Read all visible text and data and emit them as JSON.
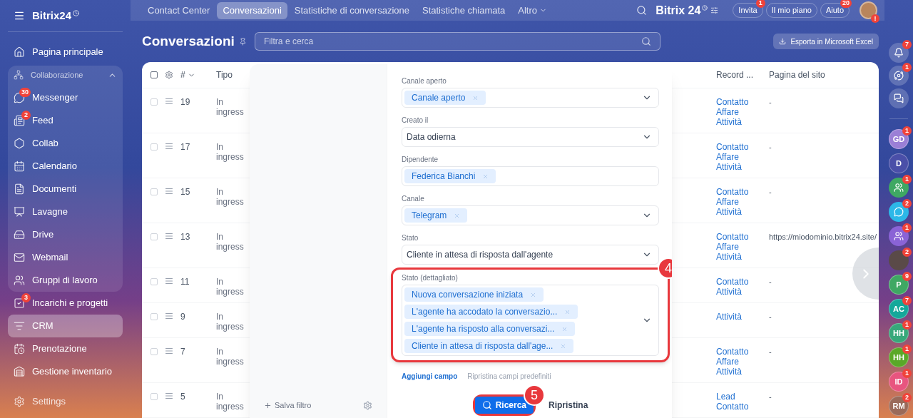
{
  "brand": {
    "name": "Bitrix24"
  },
  "sidebar": {
    "items": [
      {
        "label": "Pagina principale",
        "selected": false
      },
      {
        "label": "Collaborazione",
        "expanded": true,
        "children": [
          {
            "label": "Messenger",
            "badge": "30",
            "selected": false
          },
          {
            "label": "Feed",
            "badge": "2",
            "selected": false
          },
          {
            "label": "Collab",
            "selected": false
          },
          {
            "label": "Calendario",
            "selected": false
          },
          {
            "label": "Documenti",
            "selected": false
          },
          {
            "label": "Lavagne",
            "selected": false
          },
          {
            "label": "Drive",
            "selected": false
          },
          {
            "label": "Webmail",
            "selected": false
          },
          {
            "label": "Gruppi di lavoro",
            "selected": false
          }
        ]
      },
      {
        "label": "Incarichi e progetti",
        "badge": "3",
        "selected": false
      },
      {
        "label": "CRM",
        "selected": true
      },
      {
        "label": "Prenotazione",
        "selected": false
      },
      {
        "label": "Gestione inventario",
        "selected": false
      }
    ],
    "settings": "Settings"
  },
  "top_nav": {
    "tabs": [
      {
        "label": "Contact Center",
        "selected": false
      },
      {
        "label": "Conversazioni",
        "selected": true
      },
      {
        "label": "Statistiche di conversazione",
        "selected": false
      },
      {
        "label": "Statistiche chiamata",
        "selected": false
      },
      {
        "label": "Altro",
        "selected": false,
        "dropdown": true
      }
    ],
    "brand": "Bitrix 24",
    "buttons": [
      {
        "label": "Invita",
        "badge": "1"
      },
      {
        "label": "Il mio piano"
      },
      {
        "label": "Aiuto",
        "badge": "20"
      }
    ],
    "avatar_alert": "!"
  },
  "page": {
    "title": "Conversazioni",
    "search": {
      "placeholder": "Filtra e cerca"
    },
    "export_button": "Esporta in Microsoft Excel"
  },
  "table": {
    "all_checked": false,
    "columns": {
      "number": "#",
      "type": "Tipo",
      "record": "Record ...",
      "page": "Pagina del sito"
    },
    "rows": [
      {
        "checked": false,
        "number": "19",
        "type": "In ingress",
        "records": [
          "Contatto",
          "Affare",
          "Attività"
        ],
        "page": "-"
      },
      {
        "checked": false,
        "number": "17",
        "type": "In ingress",
        "records": [
          "Contatto",
          "Affare",
          "Attività"
        ],
        "page": "-"
      },
      {
        "checked": false,
        "number": "15",
        "type": "In ingress",
        "records": [
          "Contatto",
          "Affare",
          "Attività"
        ],
        "page": "-"
      },
      {
        "checked": false,
        "number": "13",
        "type": "In ingress",
        "records": [
          "Contatto",
          "Affare",
          "Attività"
        ],
        "page": "https://miodominio.bitrix24.site/"
      },
      {
        "checked": false,
        "number": "11",
        "type": "In ingress",
        "records": [
          "Contatto",
          "Attività"
        ],
        "page": "-"
      },
      {
        "checked": false,
        "number": "9",
        "type": "In ingress",
        "records": [
          "Attività"
        ],
        "page": "-"
      },
      {
        "checked": false,
        "number": "7",
        "type": "In ingress",
        "records": [
          "Contatto",
          "Affare",
          "Attività"
        ],
        "page": "-"
      },
      {
        "checked": false,
        "number": "5",
        "type": "In ingress",
        "records": [
          "Lead",
          "Contatto"
        ],
        "page": "-"
      }
    ]
  },
  "filter": {
    "save_filter": "Salva filtro",
    "fields": [
      {
        "kind": "tags",
        "label_text": "Canale aperto",
        "tags": [
          "Canale aperto"
        ],
        "dropdown": true
      },
      {
        "kind": "select",
        "label_text": "Creato il",
        "value": "Data odierna",
        "dropdown": true
      },
      {
        "kind": "tags",
        "label_text": "Dipendente",
        "tags": [
          "Federica Bianchi"
        ],
        "dropdown": false
      },
      {
        "kind": "tags",
        "label_text": "Canale",
        "tags": [
          "Telegram"
        ],
        "dropdown": true
      },
      {
        "kind": "select",
        "label_text": "Stato",
        "value": "Cliente in attesa di risposta dall'agente",
        "dropdown": true
      },
      {
        "kind": "tags",
        "label_text": "Stato (dettagliato)",
        "tags": [
          "Nuova conversazione iniziata",
          "L'agente ha accodato la conversazio...",
          "L'agente ha risposto alla conversazi...",
          "Cliente in attesa di risposta dall'age..."
        ],
        "dropdown": true,
        "callout": "4"
      }
    ],
    "add_field": "Aggiungi campo",
    "reset_fields": "Ripristina campi predefiniti",
    "search_button": {
      "label": "Ricerca",
      "callout": "5"
    },
    "reset_button": "Ripristina"
  },
  "right_rail": [
    {
      "kind": "icon",
      "badge": "7"
    },
    {
      "kind": "icon",
      "badge": "1"
    },
    {
      "kind": "icon"
    },
    {
      "kind": "avatar",
      "initials": "GD",
      "color": "#9b7fd6",
      "badge": "1"
    },
    {
      "kind": "avatar",
      "initials": "D",
      "color": "#4a4fa8"
    },
    {
      "kind": "group",
      "color": "#3fa863",
      "badge": "1"
    },
    {
      "kind": "chat",
      "color": "#2cb8e8",
      "badge": "2"
    },
    {
      "kind": "group",
      "color": "#8a63d6",
      "badge": "1"
    },
    {
      "kind": "photo",
      "badge": "2"
    },
    {
      "kind": "avatar",
      "initials": "P",
      "color": "#3fa863",
      "badge": "9"
    },
    {
      "kind": "avatar",
      "initials": "AC",
      "color": "#14a89a",
      "badge": "7"
    },
    {
      "kind": "avatar",
      "initials": "HH",
      "color": "#37a87a",
      "badge": "1"
    },
    {
      "kind": "avatar",
      "initials": "HH",
      "color": "#5aa828",
      "badge": "1"
    },
    {
      "kind": "avatar",
      "initials": "ID",
      "color": "#e8557f",
      "badge": "1"
    },
    {
      "kind": "avatar",
      "initials": "RM",
      "color": "#9a6a5a",
      "badge": "2"
    }
  ]
}
